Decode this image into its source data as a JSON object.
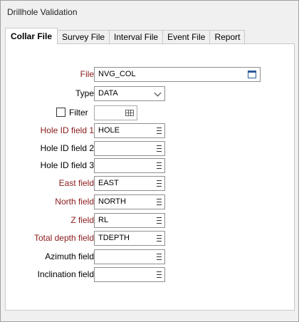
{
  "window": {
    "title": "Drillhole Validation"
  },
  "tabs": [
    {
      "label": "Collar File",
      "active": true
    },
    {
      "label": "Survey File",
      "active": false
    },
    {
      "label": "Interval File",
      "active": false
    },
    {
      "label": "Event File",
      "active": false
    },
    {
      "label": "Report",
      "active": false
    }
  ],
  "form": {
    "file": {
      "label": "File",
      "value": "NVG_COL",
      "icon": "file-browse-icon"
    },
    "type": {
      "label": "Type",
      "value": "DATA"
    },
    "filter": {
      "label": "Filter",
      "checked": false,
      "value": ""
    },
    "fields": [
      {
        "label": "Hole ID field 1",
        "value": "HOLE",
        "required": true
      },
      {
        "label": "Hole ID field 2",
        "value": "",
        "required": false
      },
      {
        "label": "Hole ID field 3",
        "value": "",
        "required": false
      },
      {
        "label": "East field",
        "value": "EAST",
        "required": true
      },
      {
        "label": "North field",
        "value": "NORTH",
        "required": true
      },
      {
        "label": "Z field",
        "value": "RL",
        "required": true
      },
      {
        "label": "Total depth field",
        "value": "TDEPTH",
        "required": true
      },
      {
        "label": "Azimuth field",
        "value": "",
        "required": false
      },
      {
        "label": "Inclination field",
        "value": "",
        "required": false
      }
    ]
  },
  "colors": {
    "required_label": "#8b1a1a",
    "border": "#8f8f8f"
  }
}
